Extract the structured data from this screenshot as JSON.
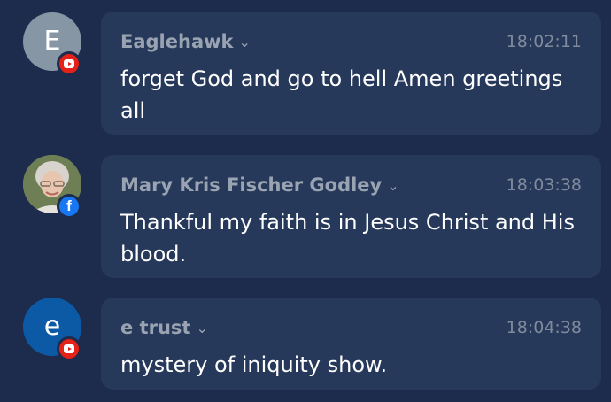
{
  "chat": {
    "messages": [
      {
        "author": "Eaglehawk",
        "avatar_initial": "E",
        "avatar_color": "#8696a5",
        "platform": "youtube",
        "platform_icon": "youtube-icon",
        "time": "18:02:11",
        "text": "forget God and go to hell Amen greetings all"
      },
      {
        "author": "Mary Kris Fischer Godley",
        "avatar_initial": "",
        "avatar_color": "photo",
        "platform": "facebook",
        "platform_icon": "facebook-icon",
        "time": "18:03:38",
        "text": "Thankful my faith is in Jesus Christ and His blood."
      },
      {
        "author": "e trust",
        "avatar_initial": "e",
        "avatar_color": "#0c5aa6",
        "platform": "youtube",
        "platform_icon": "youtube-icon",
        "time": "18:04:38",
        "text": "mystery of iniquity show."
      }
    ],
    "facebook_glyph": "f",
    "chevron_glyph": "⌄",
    "colors": {
      "background": "#1d2c4d",
      "bubble": "#27395a",
      "author": "#9aa3b1",
      "time": "#7f8a9c",
      "youtube": "#e62117",
      "facebook": "#1877f2"
    }
  }
}
